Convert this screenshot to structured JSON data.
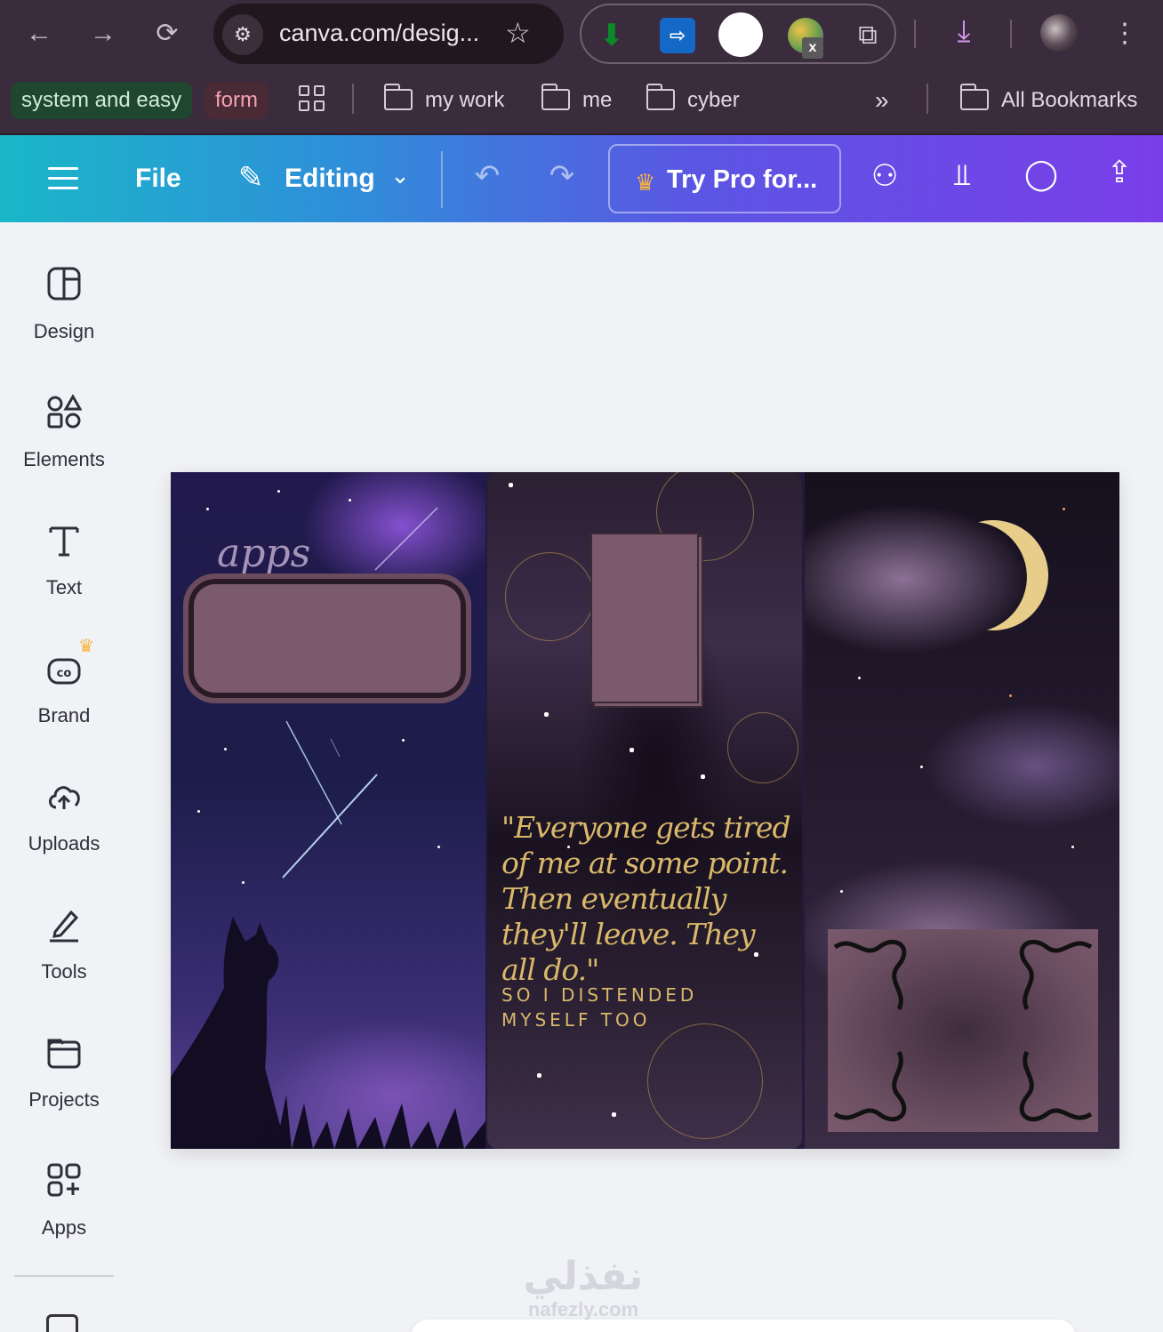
{
  "browser": {
    "url": "canva.com/desig...",
    "bookmarks": {
      "chip_green": "system and easy",
      "chip_red": "form",
      "folders": [
        "my work",
        "me",
        "cyber"
      ],
      "more": "»",
      "all_bookmarks": "All Bookmarks"
    },
    "extensions": [
      "download-extension",
      "blue-extension",
      "white-circle-extension",
      "colorful-ball-extension",
      "puzzle-extensions-icon"
    ],
    "ext_badge": "x"
  },
  "toolbar": {
    "file_label": "File",
    "editing_label": "Editing",
    "try_pro_label": "Try Pro for...",
    "colors": {
      "gradient_start": "#1ab7c8",
      "gradient_end": "#7a3ee8",
      "crown": "#f7b441"
    }
  },
  "sidebar": {
    "items": [
      {
        "label": "Design",
        "icon": "design-icon"
      },
      {
        "label": "Elements",
        "icon": "elements-icon"
      },
      {
        "label": "Text",
        "icon": "text-icon"
      },
      {
        "label": "Brand",
        "icon": "brand-icon"
      },
      {
        "label": "Uploads",
        "icon": "uploads-icon"
      },
      {
        "label": "Tools",
        "icon": "tools-icon"
      },
      {
        "label": "Projects",
        "icon": "projects-icon"
      },
      {
        "label": "Apps",
        "icon": "apps-icon"
      }
    ]
  },
  "canvas": {
    "apps_title": "apps",
    "quote": "\"Everyone gets tired of me at some point. Then eventually they'll leave. They all do.\"",
    "subquote_line1": "SO I DISTENDED",
    "subquote_line2": "MYSELF TOO",
    "colors": {
      "gold_text": "#d9b86a",
      "frame_fill": "#7a5a6c"
    }
  },
  "watermark": {
    "arabic": "نفذلي",
    "latin": "nafezly.com"
  }
}
